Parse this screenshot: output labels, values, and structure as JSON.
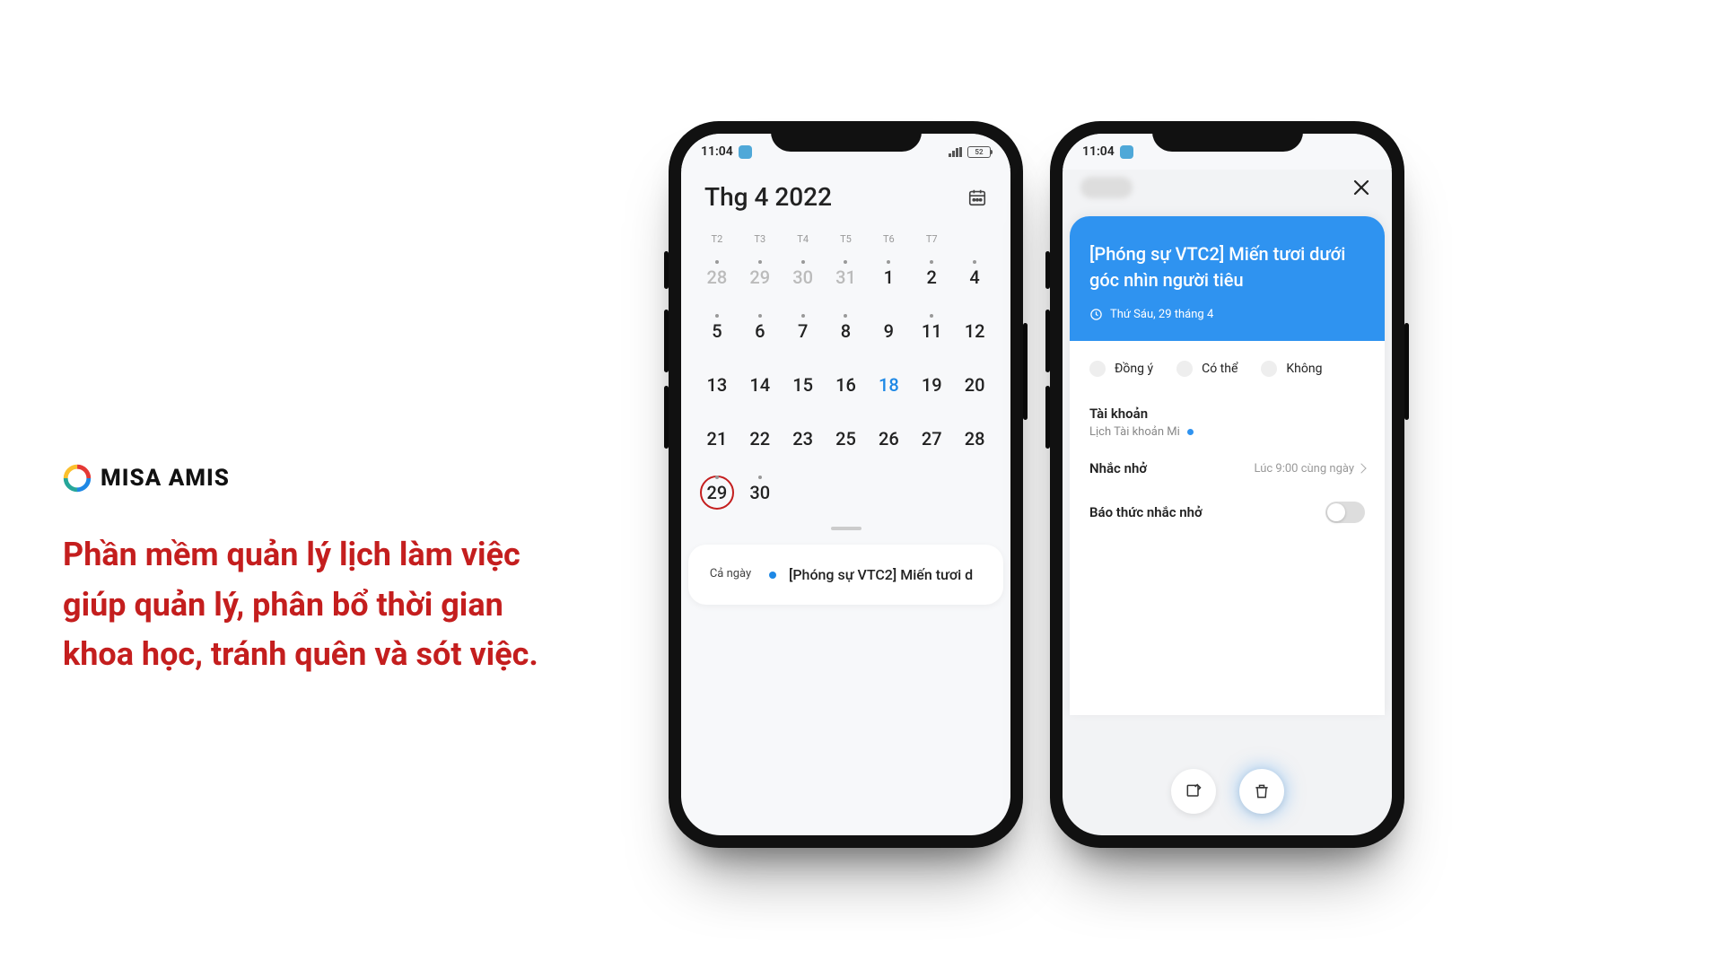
{
  "brand": {
    "name": "MISA AMIS"
  },
  "headline": "Phần mềm quản lý lịch làm việc giúp quản lý, phân bổ thời gian khoa học, tránh quên và sót việc.",
  "status": {
    "time": "11:04",
    "battery": "52"
  },
  "calendar": {
    "title": "Thg 4 2022",
    "dow": [
      "T2",
      "T3",
      "T4",
      "T5",
      "T6",
      "T7"
    ],
    "weeks": [
      [
        {
          "n": "28",
          "muted": true,
          "dot": true
        },
        {
          "n": "29",
          "muted": true,
          "dot": true
        },
        {
          "n": "30",
          "muted": true,
          "dot": true
        },
        {
          "n": "31",
          "muted": true,
          "dot": true
        },
        {
          "n": "1",
          "dot": true
        },
        {
          "n": "2",
          "dot": true
        }
      ],
      [
        {
          "n": "4",
          "dot": true
        },
        {
          "n": "5",
          "dot": true
        },
        {
          "n": "6",
          "dot": true
        },
        {
          "n": "7",
          "dot": true
        },
        {
          "n": "8",
          "dot": true
        },
        {
          "n": "9"
        }
      ],
      [
        {
          "n": "11",
          "dot": true
        },
        {
          "n": "12"
        },
        {
          "n": "13"
        },
        {
          "n": "14"
        },
        {
          "n": "15"
        },
        {
          "n": "16"
        }
      ],
      [
        {
          "n": "18",
          "today": true
        },
        {
          "n": "19"
        },
        {
          "n": "20"
        },
        {
          "n": "21"
        },
        {
          "n": "22"
        },
        {
          "n": "23"
        }
      ],
      [
        {
          "n": "25"
        },
        {
          "n": "26"
        },
        {
          "n": "27"
        },
        {
          "n": "28"
        },
        {
          "n": "29",
          "circled": true,
          "dot": true
        },
        {
          "n": "30",
          "dot": true
        }
      ]
    ],
    "event": {
      "time_label": "Cả ngày",
      "title": "[Phóng sự VTC2] Miến tươi d"
    }
  },
  "detail": {
    "title": "[Phóng sự VTC2] Miến tươi dưới góc nhìn người tiêu",
    "date": "Thứ Sáu, 29 tháng 4",
    "rsvp": [
      "Đồng ý",
      "Có thể",
      "Không"
    ],
    "account_label": "Tài khoản",
    "account_value": "Lịch Tài khoản Mi",
    "reminder_label": "Nhắc nhở",
    "reminder_value": "Lúc 9:00 cùng ngày",
    "alarm_label": "Báo thức nhắc nhở"
  },
  "colors": {
    "accent": "#2f93f0",
    "danger": "#c41e1e"
  }
}
